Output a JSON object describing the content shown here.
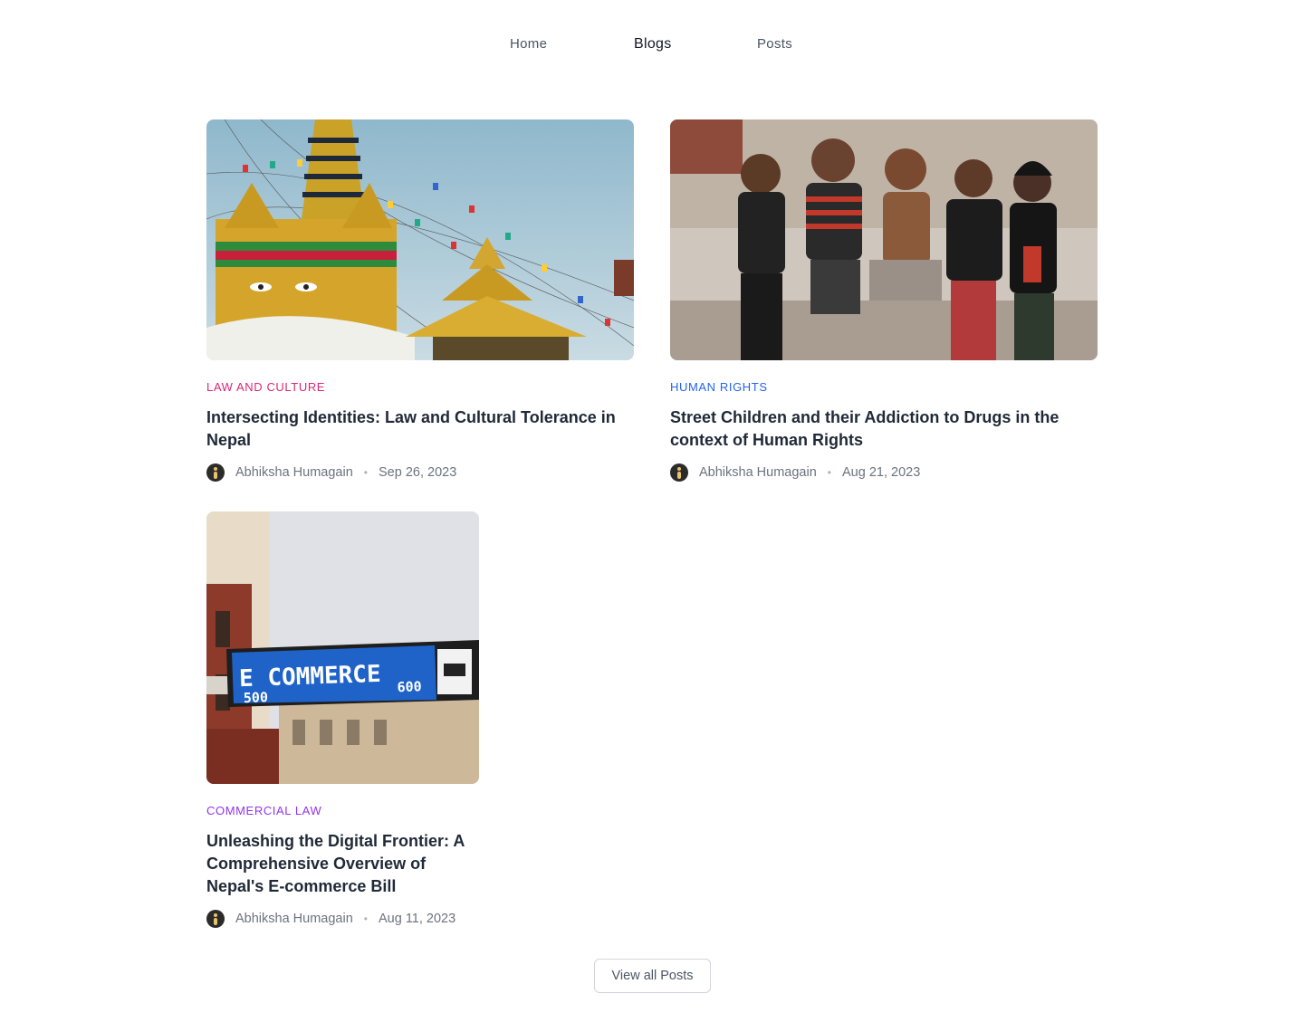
{
  "nav": {
    "items": [
      {
        "label": "Home"
      },
      {
        "label": "Blogs"
      },
      {
        "label": "Posts"
      }
    ]
  },
  "posts": [
    {
      "category": "Law and Culture",
      "category_color": "#db2777",
      "title": "Intersecting Identities: Law and Cultural Tolerance in Nepal",
      "author": "Abhiksha Humagain",
      "date": "Sep 26, 2023",
      "image": "stupa-prayer-flags-image"
    },
    {
      "category": "Human Rights",
      "category_color": "#2563eb",
      "title": "Street Children and their Addiction to Drugs in the context of Human Rights",
      "author": "Abhiksha Humagain",
      "date": "Aug 21, 2023",
      "image": "street-children-image"
    },
    {
      "category": "Commercial Law",
      "category_color": "#9333ea",
      "title": "Unleashing the Digital Frontier: A Comprehensive Overview of Nepal's E-commerce Bill",
      "author": "Abhiksha Humagain",
      "date": "Aug 11, 2023",
      "image": "ecommerce-street-sign-image",
      "sign": {
        "main": "E COMMERCE",
        "left_num": "500",
        "right_num": "600"
      }
    }
  ],
  "separator": "•",
  "view_all_label": "View all Posts"
}
